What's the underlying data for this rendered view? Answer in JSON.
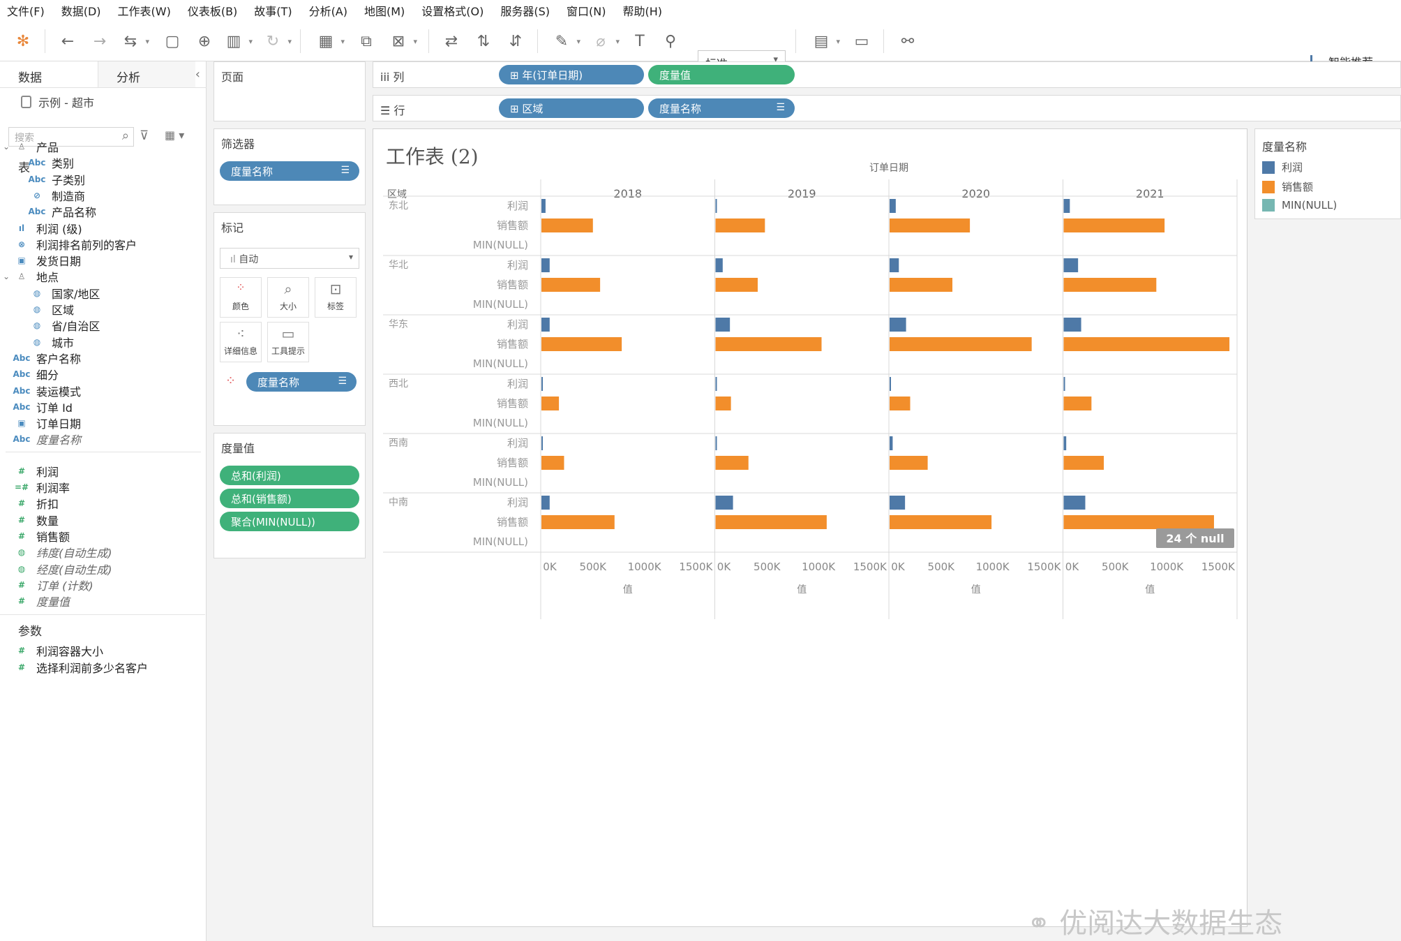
{
  "menu": [
    "文件(F)",
    "数据(D)",
    "工作表(W)",
    "仪表板(B)",
    "故事(T)",
    "分析(A)",
    "地图(M)",
    "设置格式(O)",
    "服务器(S)",
    "窗口(N)",
    "帮助(H)"
  ],
  "toolbar": {
    "view_select": "标准",
    "smart_label": "智能推荐"
  },
  "data_pane": {
    "tab_data": "数据",
    "tab_analysis": "分析",
    "datasource": "示例 - 超市",
    "search_placeholder": "搜索",
    "tables_header": "表",
    "fields": [
      {
        "label": "产品",
        "icon": "hierarchy-icon",
        "level": 0,
        "expand": true
      },
      {
        "label": "类别",
        "icon": "Abc",
        "level": 1
      },
      {
        "label": "子类别",
        "icon": "Abc",
        "level": 1
      },
      {
        "label": "制造商",
        "icon": "link-icon",
        "level": 1
      },
      {
        "label": "产品名称",
        "icon": "Abc",
        "level": 1
      },
      {
        "label": "利润 (级)",
        "icon": "bin-icon",
        "level": 0
      },
      {
        "label": "利润排名前列的客户",
        "icon": "set-icon",
        "level": 0
      },
      {
        "label": "发货日期",
        "icon": "calendar-icon",
        "level": 0
      },
      {
        "label": "地点",
        "icon": "hierarchy-icon",
        "level": 0,
        "expand": true
      },
      {
        "label": "国家/地区",
        "icon": "globe-icon",
        "level": 1
      },
      {
        "label": "区域",
        "icon": "globe-icon",
        "level": 1
      },
      {
        "label": "省/自治区",
        "icon": "globe-icon",
        "level": 1
      },
      {
        "label": "城市",
        "icon": "globe-icon",
        "level": 1
      },
      {
        "label": "客户名称",
        "icon": "Abc",
        "level": 0
      },
      {
        "label": "细分",
        "icon": "Abc",
        "level": 0
      },
      {
        "label": "装运模式",
        "icon": "Abc",
        "level": 0
      },
      {
        "label": "订单 Id",
        "icon": "Abc",
        "level": 0
      },
      {
        "label": "订单日期",
        "icon": "calendar-icon",
        "level": 0
      },
      {
        "label": "度量名称",
        "icon": "Abc",
        "level": 0,
        "italic": true
      }
    ],
    "measures": [
      {
        "label": "利润",
        "icon": "#"
      },
      {
        "label": "利润率",
        "icon": "=#"
      },
      {
        "label": "折扣",
        "icon": "#"
      },
      {
        "label": "数量",
        "icon": "#"
      },
      {
        "label": "销售额",
        "icon": "#"
      },
      {
        "label": "纬度(自动生成)",
        "icon": "globe-icon",
        "italic": true
      },
      {
        "label": "经度(自动生成)",
        "icon": "globe-icon",
        "italic": true
      },
      {
        "label": "订单 (计数)",
        "icon": "#",
        "italic": true
      },
      {
        "label": "度量值",
        "icon": "#",
        "italic": true
      }
    ],
    "params_header": "参数",
    "params": [
      {
        "label": "利润容器大小",
        "icon": "#"
      },
      {
        "label": "选择利润前多少名客户",
        "icon": "#"
      }
    ]
  },
  "pages_card": {
    "title": "页面"
  },
  "filters_card": {
    "title": "筛选器",
    "pill": "度量名称"
  },
  "marks_card": {
    "title": "标记",
    "mark_type": "自动",
    "buttons": [
      "颜色",
      "大小",
      "标签",
      "详细信息",
      "工具提示"
    ],
    "pill": "度量名称"
  },
  "measure_values_card": {
    "title": "度量值",
    "pills": [
      "总和(利润)",
      "总和(销售额)",
      "聚合(MIN(NULL))"
    ]
  },
  "columns_shelf": {
    "label": "列",
    "pills": [
      "年(订单日期)",
      "度量值"
    ]
  },
  "rows_shelf": {
    "label": "行",
    "pills": [
      "区域",
      "度量名称"
    ]
  },
  "worksheet": {
    "title": "工作表 (2)"
  },
  "legend": {
    "title": "度量名称",
    "items": [
      {
        "label": "利润",
        "color": "#4e79a7"
      },
      {
        "label": "销售额",
        "color": "#f28e2b"
      },
      {
        "label": "MIN(NULL)",
        "color": "#76b7b2"
      }
    ]
  },
  "chart_data": {
    "type": "bar",
    "column_header": "订单日期",
    "row_header": "区域",
    "years": [
      "2018",
      "2019",
      "2020",
      "2021"
    ],
    "regions": [
      "东北",
      "华北",
      "华东",
      "西北",
      "西南",
      "中南"
    ],
    "measures": [
      "利润",
      "销售额",
      "MIN(NULL)"
    ],
    "x_ticks": [
      "0K",
      "500K",
      "1000K",
      "1500K"
    ],
    "xlim": [
      0,
      1650000
    ],
    "x_axis_label": "值",
    "null_badge": "24 个 null",
    "values": {
      "利润": [
        [
          40000,
          10000,
          60000,
          60000
        ],
        [
          80000,
          70000,
          90000,
          140000
        ],
        [
          80000,
          140000,
          160000,
          170000
        ],
        [
          10000,
          10000,
          10000,
          10000
        ],
        [
          5000,
          5000,
          30000,
          25000
        ],
        [
          80000,
          170000,
          150000,
          210000
        ]
      ],
      "销售额": [
        [
          500000,
          480000,
          780000,
          980000
        ],
        [
          570000,
          410000,
          610000,
          900000
        ],
        [
          780000,
          1030000,
          1380000,
          1610000
        ],
        [
          170000,
          150000,
          200000,
          270000
        ],
        [
          220000,
          320000,
          370000,
          390000
        ],
        [
          710000,
          1080000,
          990000,
          1460000
        ]
      ]
    }
  }
}
